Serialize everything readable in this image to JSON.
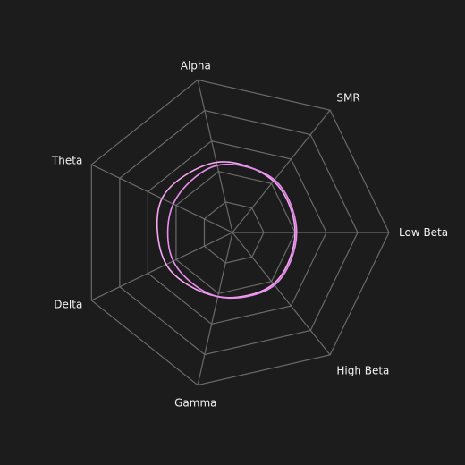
{
  "chart_data": {
    "type": "radar",
    "axes": [
      "Low Beta",
      "High Beta",
      "Gamma",
      "Delta",
      "Theta",
      "Alpha",
      "SMR"
    ],
    "grid_levels": 5,
    "rmax": 1.0,
    "grid": true,
    "curve_style": "smooth",
    "series": [
      {
        "values": [
          0.4,
          0.42,
          0.42,
          0.47,
          0.5,
          0.46,
          0.42
        ],
        "color": "#f6a6f1"
      },
      {
        "values": [
          0.41,
          0.43,
          0.42,
          0.42,
          0.42,
          0.44,
          0.43
        ],
        "color": "#e88cf0"
      }
    ]
  },
  "colors": {
    "background": "#1d1c1c",
    "grid": "#6a6a6a",
    "text": "#f2f2f2"
  }
}
